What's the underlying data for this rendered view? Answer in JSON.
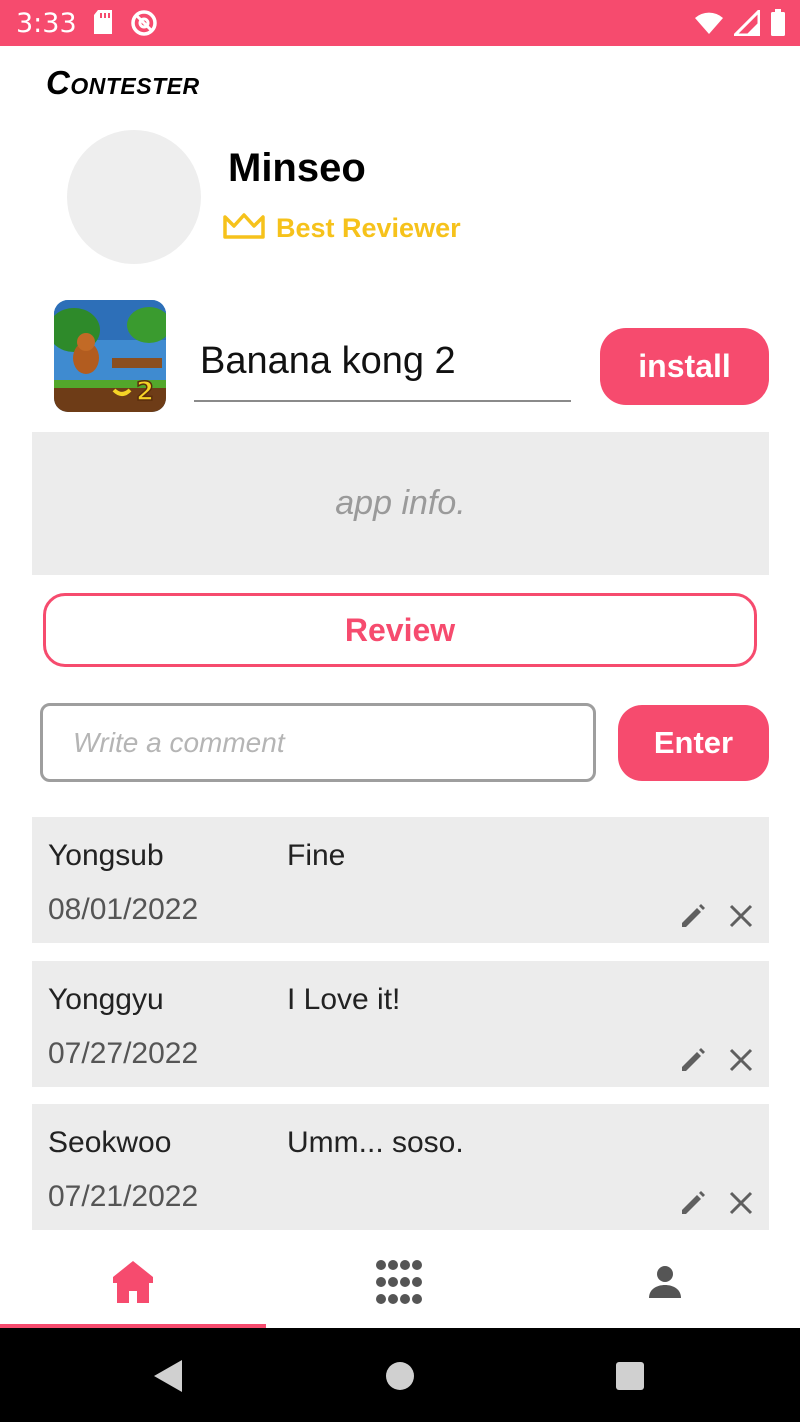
{
  "status_bar": {
    "time": "3:33",
    "left_icons": [
      "sd-card-icon",
      "at-sign-icon"
    ],
    "right_icons": [
      "wifi-icon",
      "signal-icon",
      "battery-icon"
    ],
    "color": "#f64b6e"
  },
  "brand": {
    "title": "Contester"
  },
  "profile": {
    "name": "Minseo",
    "badge_icon": "crown-icon",
    "badge_label": "Best Reviewer",
    "badge_color": "#f6c21b"
  },
  "app": {
    "name": "Banana kong 2",
    "install_label": "install",
    "info_placeholder": "app info."
  },
  "review": {
    "button_label": "Review"
  },
  "comment_form": {
    "placeholder": "Write a comment",
    "value": "",
    "enter_label": "Enter"
  },
  "comments": [
    {
      "author": "Yongsub",
      "date": "08/01/2022",
      "text": "Fine"
    },
    {
      "author": "Yonggyu",
      "date": "07/27/2022",
      "text": "I Love it!"
    },
    {
      "author": "Seokwoo",
      "date": "07/21/2022",
      "text": "Umm... soso."
    }
  ],
  "bottom_nav": {
    "items": [
      {
        "icon": "home-icon",
        "active": true
      },
      {
        "icon": "grid-icon",
        "active": false
      },
      {
        "icon": "person-icon",
        "active": false
      }
    ],
    "accent": "#f64b6e"
  },
  "system_nav": {
    "buttons": [
      "back-icon",
      "home-circle-icon",
      "recents-icon"
    ]
  }
}
